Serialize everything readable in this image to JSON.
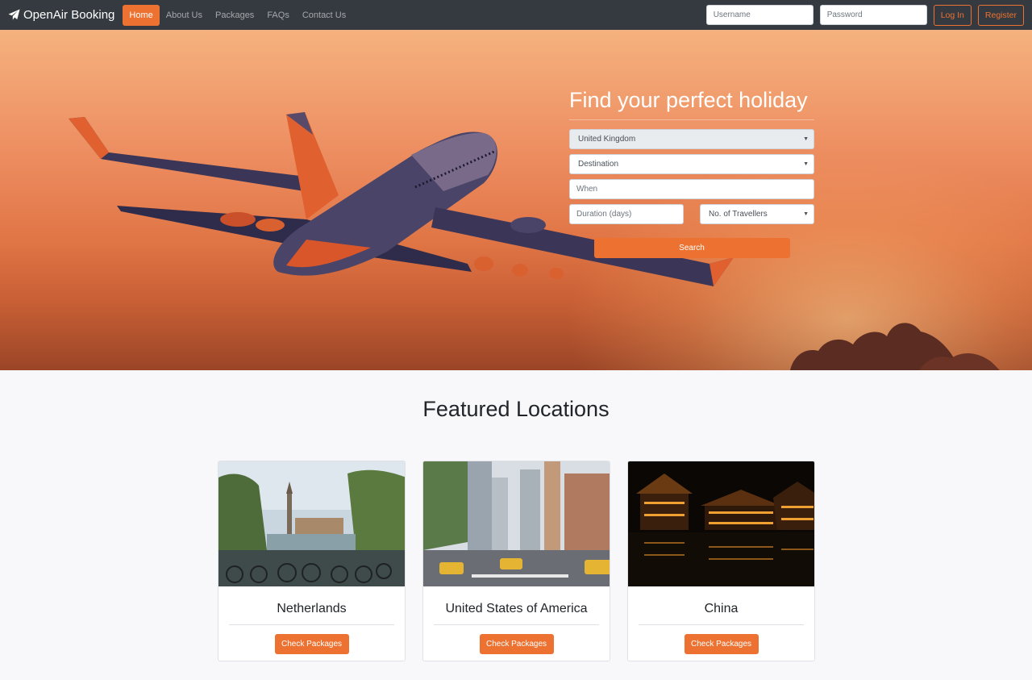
{
  "navbar": {
    "brand": "OpenAir Booking",
    "links": [
      "Home",
      "About Us",
      "Packages",
      "FAQs",
      "Contact Us"
    ],
    "active_link": "Home",
    "username_placeholder": "Username",
    "password_placeholder": "Password",
    "login_label": "Log In",
    "register_label": "Register"
  },
  "search": {
    "title": "Find your perfect holiday",
    "origin": "United Kingdom",
    "destination": "Destination",
    "when": "When",
    "duration": "Duration (days)",
    "travellers": "No. of Travellers",
    "button": "Search"
  },
  "featured": {
    "title": "Featured Locations",
    "cards": [
      {
        "name": "Netherlands",
        "button": "Check Packages"
      },
      {
        "name": "United States of America",
        "button": "Check Packages"
      },
      {
        "name": "China",
        "button": "Check Packages"
      }
    ]
  },
  "colors": {
    "accent": "#ed7231",
    "navbar_bg": "#343a40",
    "page_bg": "#f8f8fa"
  },
  "icons": {
    "brand": "paper-plane-icon",
    "select": "caret-down-icon"
  }
}
